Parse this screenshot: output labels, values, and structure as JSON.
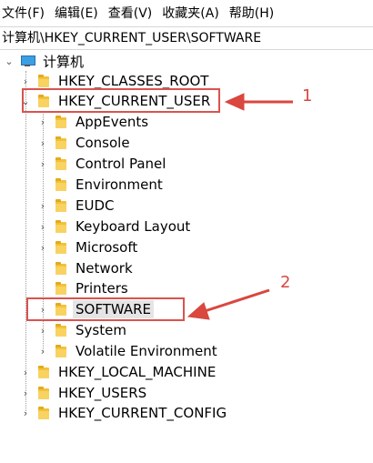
{
  "menu": [
    "文件(F)",
    "编辑(E)",
    "查看(V)",
    "收藏夹(A)",
    "帮助(H)"
  ],
  "address": "计算机\\HKEY_CURRENT_USER\\SOFTWARE",
  "tree": {
    "root": "计算机",
    "items": [
      {
        "label": "HKEY_CLASSES_ROOT",
        "expander": "›"
      },
      {
        "label": "HKEY_CURRENT_USER",
        "expander": "⌄"
      },
      {
        "label": "AppEvents",
        "expander": "›"
      },
      {
        "label": "Console",
        "expander": "›"
      },
      {
        "label": "Control Panel",
        "expander": "›"
      },
      {
        "label": "Environment",
        "expander": ""
      },
      {
        "label": "EUDC",
        "expander": "›"
      },
      {
        "label": "Keyboard Layout",
        "expander": "›"
      },
      {
        "label": "Microsoft",
        "expander": "›"
      },
      {
        "label": "Network",
        "expander": ""
      },
      {
        "label": "Printers",
        "expander": ""
      },
      {
        "label": "SOFTWARE",
        "expander": "›"
      },
      {
        "label": "System",
        "expander": "›"
      },
      {
        "label": "Volatile Environment",
        "expander": "›"
      },
      {
        "label": "HKEY_LOCAL_MACHINE",
        "expander": "›"
      },
      {
        "label": "HKEY_USERS",
        "expander": "›"
      },
      {
        "label": "HKEY_CURRENT_CONFIG",
        "expander": "›"
      }
    ]
  },
  "annotations": {
    "callout_1": "1",
    "callout_2": "2",
    "color": "#d9473f"
  }
}
